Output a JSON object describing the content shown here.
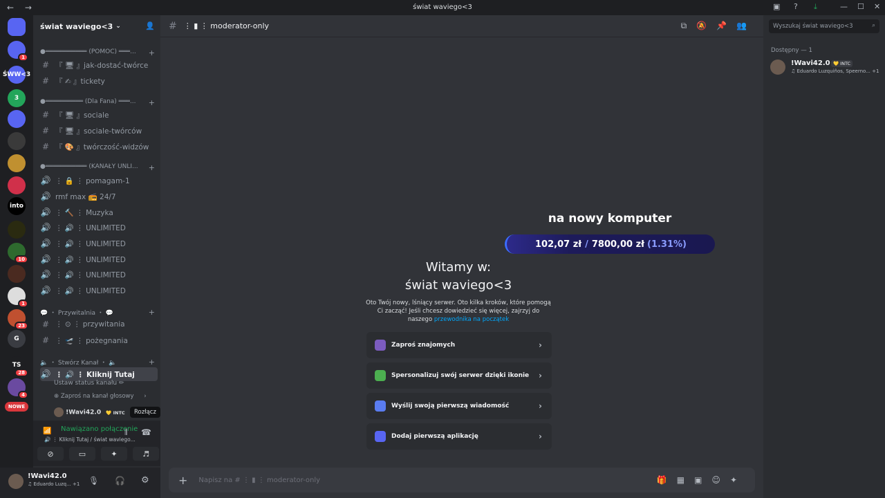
{
  "window": {
    "title": "świat waviego<3",
    "nav_icons": "← →"
  },
  "server": {
    "name": "świat waviego<3"
  },
  "servers": [
    {
      "name": "discord-home",
      "color": "#5865f2",
      "label": ""
    },
    {
      "name": "server-discord",
      "color": "#5865f2",
      "badge": "1",
      "label": ""
    },
    {
      "name": "server-swiat",
      "color": "#5865f2",
      "label": "ŚWW<3"
    },
    {
      "name": "server-green",
      "color": "#23a55a",
      "label": "3"
    },
    {
      "name": "server-bot",
      "color": "#5865f2",
      "label": ""
    },
    {
      "name": "server-dark",
      "color": "#3a3a3a",
      "label": ""
    },
    {
      "name": "server-gold",
      "color": "#c09030",
      "label": ""
    },
    {
      "name": "server-red",
      "color": "#d0304a",
      "label": ""
    },
    {
      "name": "server-intocn",
      "color": "#000000",
      "label": "into"
    },
    {
      "name": "server-yellow",
      "color": "#2a2a10",
      "label": ""
    },
    {
      "name": "server-green2",
      "color": "#2e6a2e",
      "badge": "10",
      "label": ""
    },
    {
      "name": "server-photo",
      "color": "#4a2a20",
      "label": ""
    },
    {
      "name": "server-white",
      "color": "#ddd",
      "badge": "1",
      "label": ""
    },
    {
      "name": "server-anime",
      "color": "#c05030",
      "badge": "23",
      "label": ""
    },
    {
      "name": "server-heart",
      "color": "#3a3c42",
      "label": "G"
    },
    {
      "name": "server-ts",
      "color": "#1e1f22",
      "badge": "28",
      "label": "TS"
    },
    {
      "name": "server-purple",
      "color": "#6a4aa0",
      "badge": "4",
      "label": ""
    },
    {
      "name": "server-new",
      "color": "#da373c",
      "label": "NOWE"
    }
  ],
  "categories": [
    {
      "label": "●═══════════ (POMOC) ═══..."
    },
    {
      "label": "●══════════ (Dla Fana) ═══..."
    },
    {
      "label": "●═══════════ (KANAŁY UNLI..."
    },
    {
      "label": "💬 ・ Przywitalnia ・ 💬"
    },
    {
      "label": "🔈 ・ Stwórz Kanał ・ 🔈"
    }
  ],
  "channels": [
    {
      "sym": "#",
      "label": "『 🖥 』jak-dostać-twórce"
    },
    {
      "sym": "#",
      "label": "『 ✍ 』tickety"
    },
    {
      "sym": "#",
      "label": "『 🖥 』sociale"
    },
    {
      "sym": "#",
      "label": "『 🖥 』sociale-twórców"
    },
    {
      "sym": "#",
      "label": "『 🎨 』twórczość-widzów"
    },
    {
      "sym": "🔊",
      "label": "⋮ 🔒 ⋮ pomagam-1"
    },
    {
      "sym": "🔊",
      "label": "rmf max 📻 24/7"
    },
    {
      "sym": "🔊",
      "label": "⋮ 🔨 ⋮ Muzyka"
    },
    {
      "sym": "🔊",
      "label": "⋮ 🔊 ⋮ UNLIMITED"
    },
    {
      "sym": "🔊",
      "label": "⋮ 🔊 ⋮ UNLIMITED"
    },
    {
      "sym": "🔊",
      "label": "⋮ 🔊 ⋮ UNLIMITED"
    },
    {
      "sym": "🔊",
      "label": "⋮ 🔊 ⋮ UNLIMITED"
    },
    {
      "sym": "🔊",
      "label": "⋮ 🔊 ⋮ UNLIMITED"
    },
    {
      "sym": "#",
      "label": "⋮ ⊙ ⋮ przywitania"
    },
    {
      "sym": "#",
      "label": "⋮ 🛫 ⋮ pożegnania"
    },
    {
      "sym": "🔊",
      "label": "⋮ 🔊 ⋮ Kliknij Tutaj"
    }
  ],
  "voice": {
    "status_set": "Ustaw status kanału ✏",
    "invite": "Zaproś na kanał głosowy",
    "member": "!Wavi42.0",
    "member_tag": "💛 INTC",
    "tooltip": "Rozłącz",
    "connected": "Nawiązano połączenie",
    "connected_sub": "🔊 ⋮ Kliknij Tutaj / świat waviego..."
  },
  "user": {
    "name": "!Wavi42.0",
    "activity": "♫ Eduardo Luzq...  +1"
  },
  "main": {
    "channel_name": "⋮ ▮ ⋮ moderator-only",
    "welcome_title_1": "Witamy w:",
    "welcome_title_2": "świat waviego<3",
    "welcome_text": "Oto Twój nowy, lśniący serwer. Oto kilka kroków, które pomogą Ci zacząć! Jeśli chcesz dowiedzieć się więcej, zajrzyj do naszego",
    "welcome_link": "przewodnika na początek",
    "cards": [
      {
        "label": "Zaproś znajomych",
        "color": "#7c5cbf"
      },
      {
        "label": "Spersonalizuj swój serwer dzięki ikonie",
        "color": "#4caf50"
      },
      {
        "label": "Wyślij swoją pierwszą wiadomość",
        "color": "#5a7cf0"
      },
      {
        "label": "Dodaj pierwszą aplikację",
        "color": "#5865f2"
      }
    ],
    "input_placeholder": "Napisz na # ⋮ ▮ ⋮ moderator-only"
  },
  "overlay": {
    "title": "na nowy komputer",
    "amount": "102,07 zł",
    "separator": "/",
    "goal": "7800,00 zł",
    "percent": "(1.31%)",
    "progress": 0.0131
  },
  "members": {
    "search_placeholder": "Wyszukaj świat waviego<3",
    "header": "Dostępny — 1",
    "list": [
      {
        "name": "!Wavi42.0",
        "tag": "💛 INTC",
        "activity": "♫ Eduardo Luzquiños, Speerno...  +1"
      }
    ]
  }
}
